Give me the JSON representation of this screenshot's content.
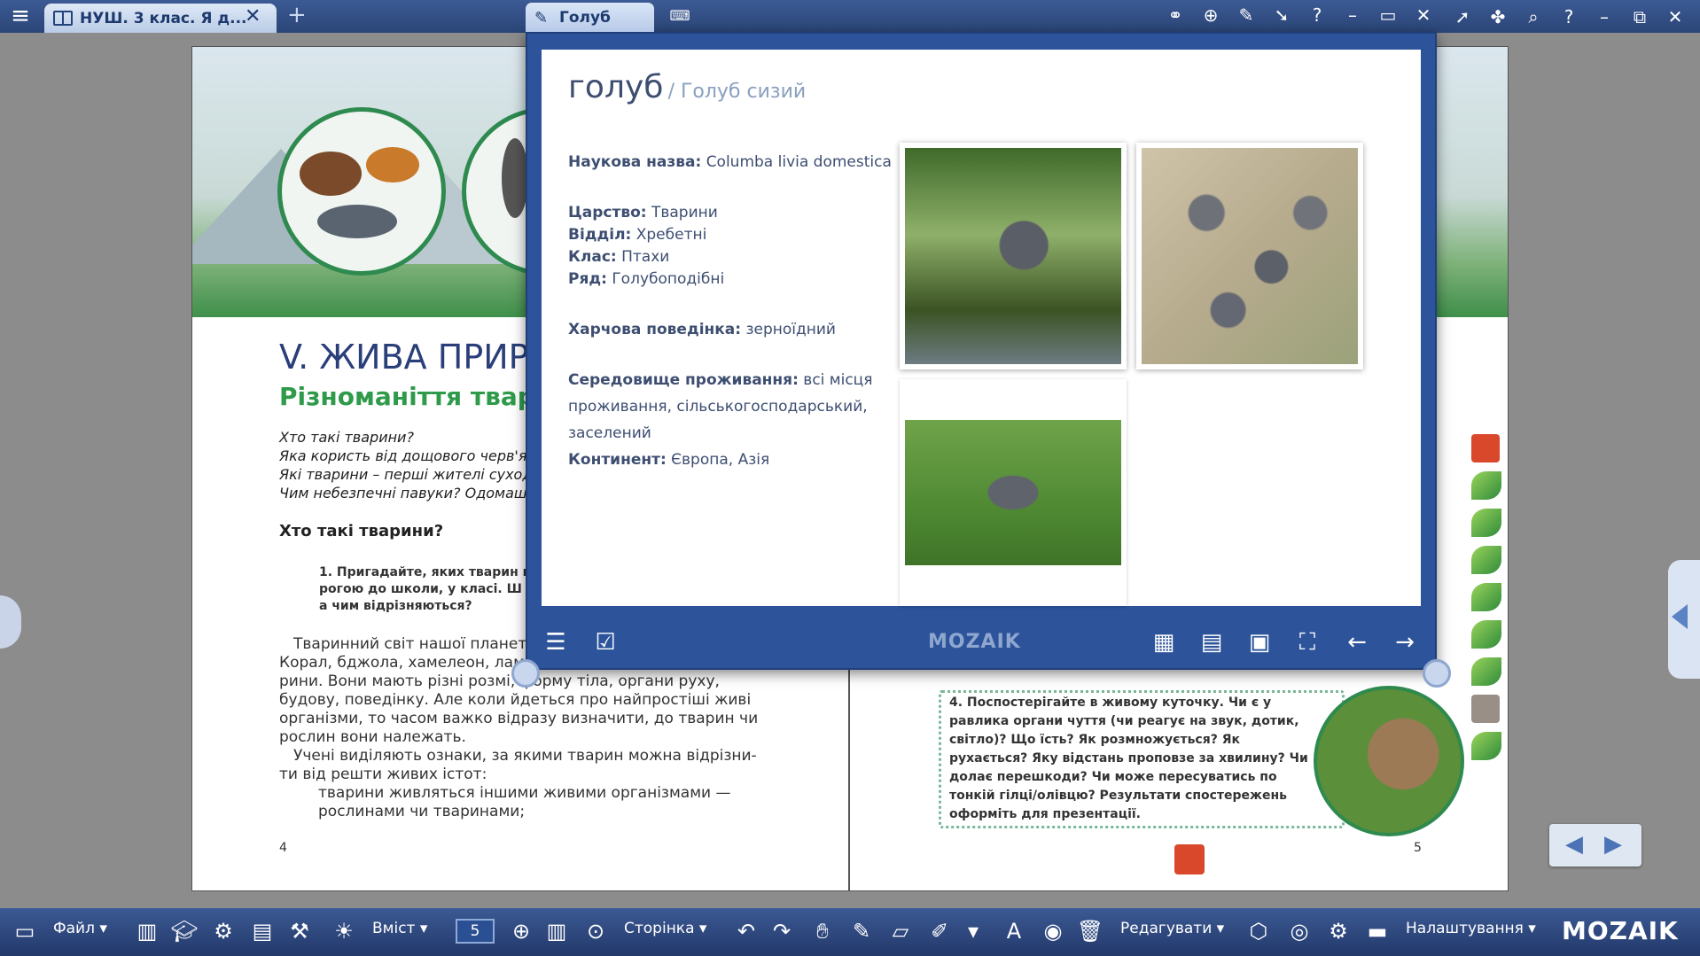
{
  "app": {
    "tab_title": "НУШ. 3 клас. Я д...",
    "tab_close": "✕",
    "new_tab": "+",
    "menu_icon": "hamburger-icon"
  },
  "book": {
    "left_page": {
      "chapter_title": "V. ЖИВА ПРИРО",
      "chapter_sub": "Різноманіття твар",
      "questions": [
        "Хто такі тварини?",
        "Яка користь від дощового черв'як",
        "Які тварини – перші жителі суходо",
        "Чим небезпечні павуки? Одомашн"
      ],
      "section_head": "Хто такі тварини?",
      "task1_lines": [
        "1. Пригадайте, яких тварин ви",
        "рогою до школи, у класі. Ш",
        "а чим відрізняються?"
      ],
      "body_lines": [
        "Тваринний світ нашої планети",
        "Корал, бджола, хамелеон, лам",
        "рини. Вони мають різні розмі, форму тіла, органи руху,",
        "будову, поведінку. Але коли йдеться про найпростіші живі",
        "організми, то часом важко відразу визначити, до тварин чи",
        "рослин вони належать.",
        "Учені виділяють ознаки, за якими тварин можна відрізни-",
        "ти від решти живих істот:",
        "тварини живляться іншими живими організмами —",
        "рослинами чи тваринами;"
      ],
      "page_number": "4"
    },
    "right_page": {
      "task4": "4. Поспостерігайте в живому куточку. Чи є у равлика органи чуття (чи реагує на звук, дотик, світло)? Що їсть? Як розмножується? Як рухається? Яку відстань проповзе за хвилину? Чи долає перешкоди? Чи може пересуватись по тонкій гілці/олівцю? Результати спостережень оформіть для презентації.",
      "page_number": "5"
    }
  },
  "popup": {
    "tab_title": "Голуб",
    "species_name": "голуб",
    "species_sub": "/ Голуб сизий",
    "fields": [
      {
        "label": "Наукова назва:",
        "value": "Columba livia domestica"
      },
      {
        "label": "Царство:",
        "value": "Тварини"
      },
      {
        "label": "Відділ:",
        "value": "Хребетні"
      },
      {
        "label": "Клас:",
        "value": "Птахи"
      },
      {
        "label": "Ряд:",
        "value": "Голубоподібні"
      },
      {
        "label": "Харчова поведінка:",
        "value": "зерноїдний"
      },
      {
        "label": "Середовище проживання:",
        "value": "всі місця проживання, сільськогосподарський, заселений"
      },
      {
        "label": "Континент:",
        "value": "Європа, Азія"
      }
    ],
    "brand": "MOZAIK"
  },
  "toolbar": {
    "file": "Файл",
    "contents": "Вміст",
    "page_value": "5",
    "page": "Сторінка",
    "edit": "Редагувати",
    "settings": "Налаштування",
    "logo": "MOZAIK"
  },
  "colors": {
    "chrome": "#2d549b",
    "text": "#3d4e71",
    "accent_green": "#2f9a4a"
  }
}
